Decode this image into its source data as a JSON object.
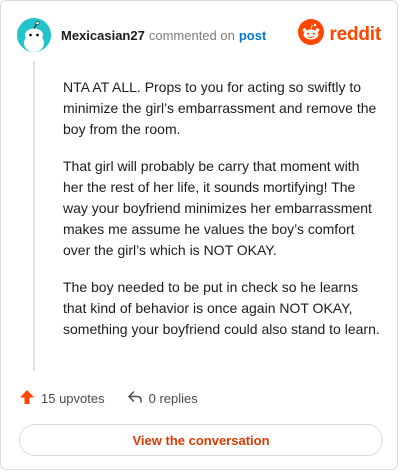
{
  "header": {
    "username": "Mexicasian27",
    "action_text": "commented on",
    "post_link": "post",
    "brand": "reddit"
  },
  "comment": {
    "paragraphs": [
      "NTA AT ALL. Props to you for acting so swiftly to minimize the girl’s embarrassment and remove the boy from the room.",
      "That girl will probably be carry that moment with her the rest of her life, it sounds mortifying! The way your boyfriend minimizes her embarrassment makes me assume he values the boy’s comfort over the girl’s which is NOT OKAY.",
      "The boy needed to be put in check so he learns that kind of behavior is once again NOT OKAY, something your boyfriend could also stand to learn."
    ]
  },
  "actions": {
    "upvotes": "15 upvotes",
    "replies": "0 replies"
  },
  "cta": {
    "label": "View the conversation"
  },
  "colors": {
    "accent": "#ff4500",
    "link": "#0079d3",
    "avatar": "#22c3c9",
    "cta_text": "#d93a00"
  },
  "icons": {
    "avatar": "snoo-avatar-icon",
    "brand": "reddit-logo-icon",
    "upvote": "upvote-arrow-icon",
    "reply": "reply-arrow-icon"
  }
}
